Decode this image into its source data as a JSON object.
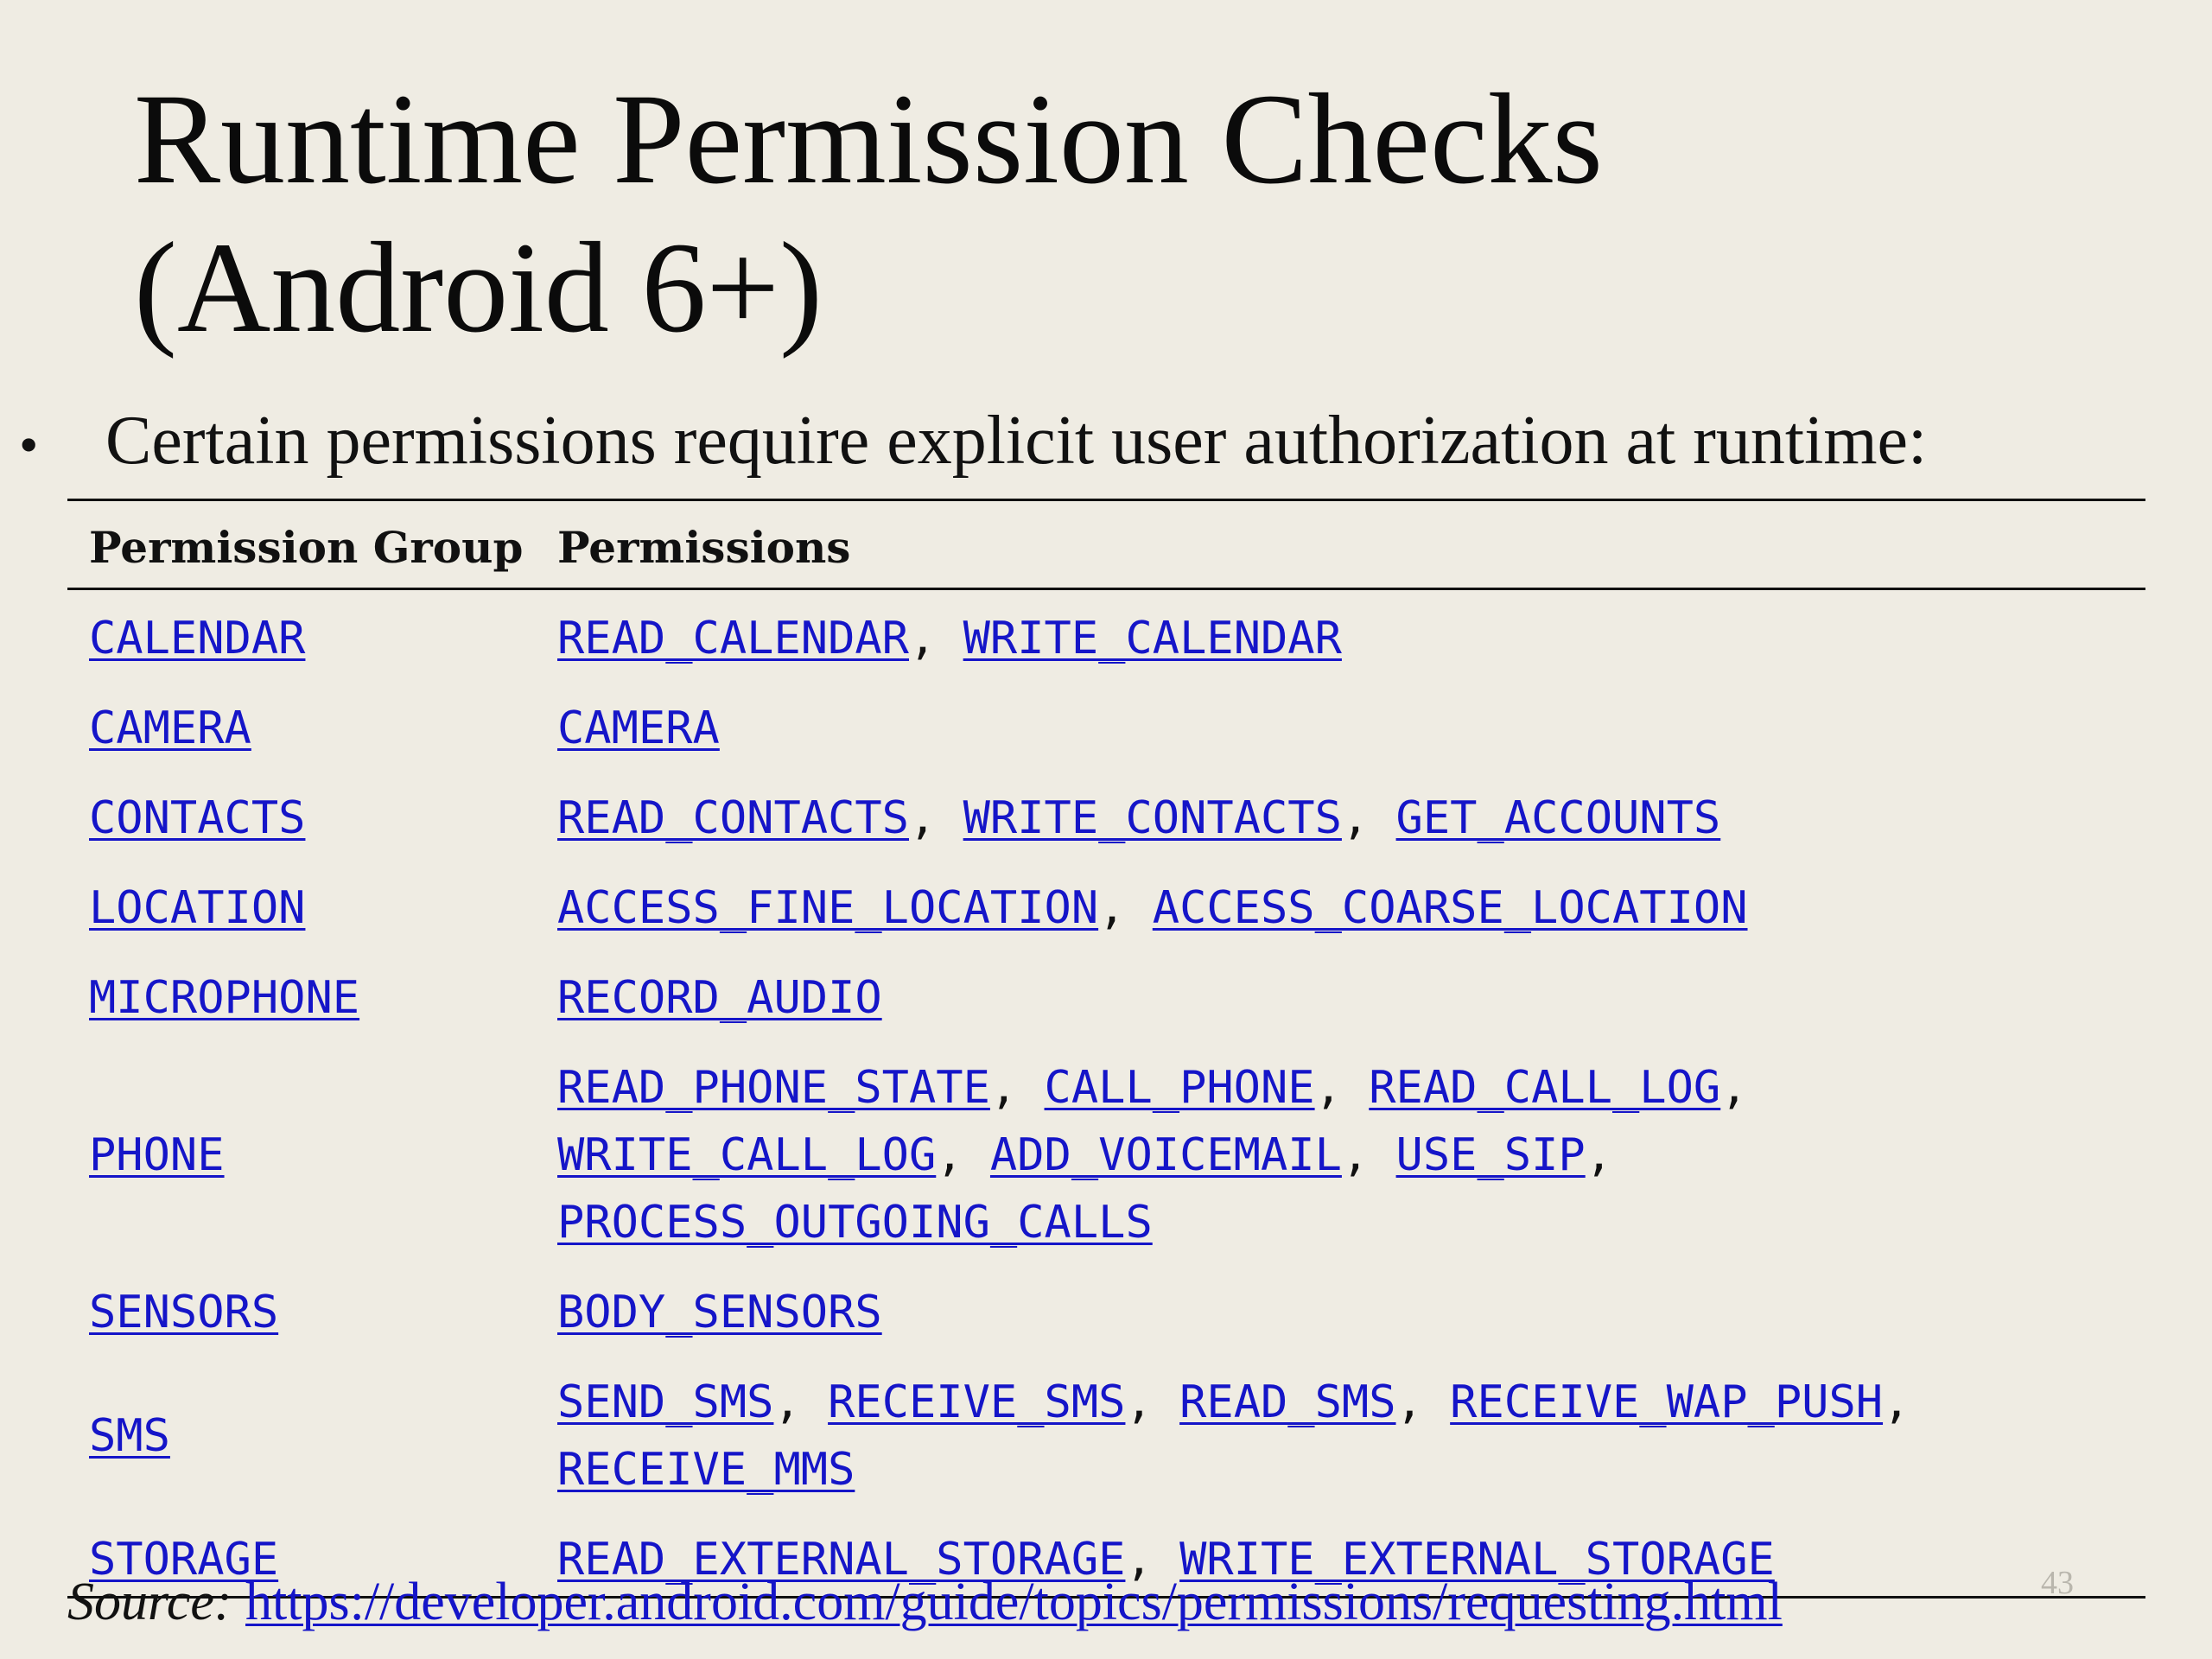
{
  "slide": {
    "title_line1": "Runtime Permission Checks",
    "title_line2": "(Android 6+)",
    "bullet_text": "Certain permissions require explicit user authorization at runtime:",
    "source_label": "Source:",
    "source_url": "https://developer.android.com/guide/topics/permissions/requesting.html",
    "page_number": "43",
    "colors": {
      "background": "#efece3",
      "link": "#1515c8",
      "text": "#111111",
      "page_number": "#b9b6ad"
    }
  },
  "table": {
    "headers": {
      "group": "Permission Group",
      "permissions": "Permissions"
    },
    "rows": [
      {
        "group": "CALENDAR",
        "lines": [
          [
            "READ_CALENDAR",
            "WRITE_CALENDAR"
          ]
        ]
      },
      {
        "group": "CAMERA",
        "lines": [
          [
            "CAMERA"
          ]
        ]
      },
      {
        "group": "CONTACTS",
        "lines": [
          [
            "READ_CONTACTS",
            "WRITE_CONTACTS",
            "GET_ACCOUNTS"
          ]
        ]
      },
      {
        "group": "LOCATION",
        "lines": [
          [
            "ACCESS_FINE_LOCATION",
            "ACCESS_COARSE_LOCATION"
          ]
        ]
      },
      {
        "group": "MICROPHONE",
        "lines": [
          [
            "RECORD_AUDIO"
          ]
        ]
      },
      {
        "group": "PHONE",
        "lines": [
          [
            "READ_PHONE_STATE",
            "CALL_PHONE",
            "READ_CALL_LOG"
          ],
          [
            "WRITE_CALL_LOG",
            "ADD_VOICEMAIL",
            "USE_SIP"
          ],
          [
            "PROCESS_OUTGOING_CALLS"
          ]
        ]
      },
      {
        "group": "SENSORS",
        "lines": [
          [
            "BODY_SENSORS"
          ]
        ]
      },
      {
        "group": "SMS",
        "lines": [
          [
            "SEND_SMS",
            "RECEIVE_SMS",
            "READ_SMS",
            "RECEIVE_WAP_PUSH"
          ],
          [
            "RECEIVE_MMS"
          ]
        ]
      },
      {
        "group": "STORAGE",
        "lines": [
          [
            "READ_EXTERNAL_STORAGE",
            "WRITE_EXTERNAL_STORAGE"
          ]
        ]
      }
    ]
  }
}
